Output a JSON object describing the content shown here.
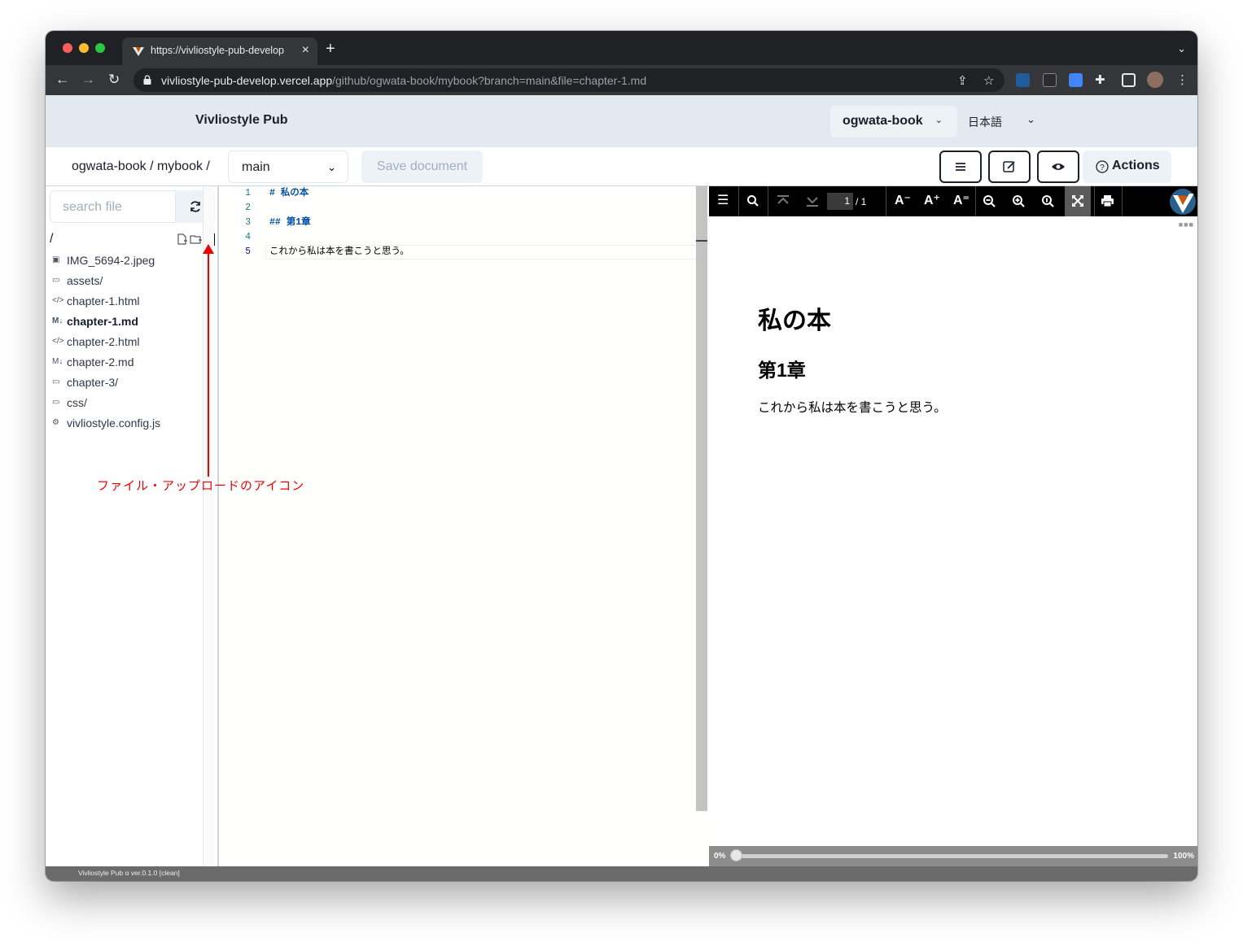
{
  "browser": {
    "tab_title": "https://vivliostyle-pub-develop",
    "tab_close": "×",
    "new_tab": "+",
    "url_host": "vivliostyle-pub-develop.vercel.app",
    "url_path": "/github/ogwata-book/mybook?branch=main&file=chapter-1.md"
  },
  "app": {
    "brand": "Vivliostyle Pub",
    "user": "ogwata-book",
    "language": "日本語"
  },
  "repobar": {
    "path": "ogwata-book / mybook /",
    "branch": "main",
    "save_label": "Save document",
    "actions_label": "Actions"
  },
  "sidebar": {
    "search_placeholder": "search file",
    "root": "/",
    "files": [
      {
        "name": "IMG_5694-2.jpeg",
        "icon": "image-file-icon",
        "glyph": "▣"
      },
      {
        "name": "assets/",
        "icon": "folder-icon",
        "glyph": "▭"
      },
      {
        "name": "chapter-1.html",
        "icon": "code-icon",
        "glyph": "</>"
      },
      {
        "name": "chapter-1.md",
        "icon": "markdown-icon",
        "glyph": "M↓",
        "active": true
      },
      {
        "name": "chapter-2.html",
        "icon": "code-icon",
        "glyph": "</>"
      },
      {
        "name": "chapter-2.md",
        "icon": "markdown-icon",
        "glyph": "M↓"
      },
      {
        "name": "chapter-3/",
        "icon": "folder-icon",
        "glyph": "▭"
      },
      {
        "name": "css/",
        "icon": "folder-icon",
        "glyph": "▭"
      },
      {
        "name": "vivliostyle.config.js",
        "icon": "gear-icon",
        "glyph": "⚙"
      }
    ]
  },
  "editor": {
    "line_numbers": [
      "1",
      "2",
      "3",
      "4",
      "5"
    ],
    "lines": [
      "# 私の本",
      "",
      "## 第1章",
      "",
      "これから私は本を書こうと思う。"
    ]
  },
  "viewer": {
    "page_current": "1",
    "page_total": "/ 1",
    "h1": "私の本",
    "h2": "第1章",
    "paragraph": "これから私は本を書こうと思う。",
    "progress_start": "0%",
    "progress_end": "100%",
    "progress_value": 0
  },
  "footer": {
    "version": "Vivliostyle Pub α ver.0.1.0 [clean]"
  },
  "annotation": {
    "text": "ファイル・アップロードのアイコン",
    "color": "#ee0000"
  }
}
